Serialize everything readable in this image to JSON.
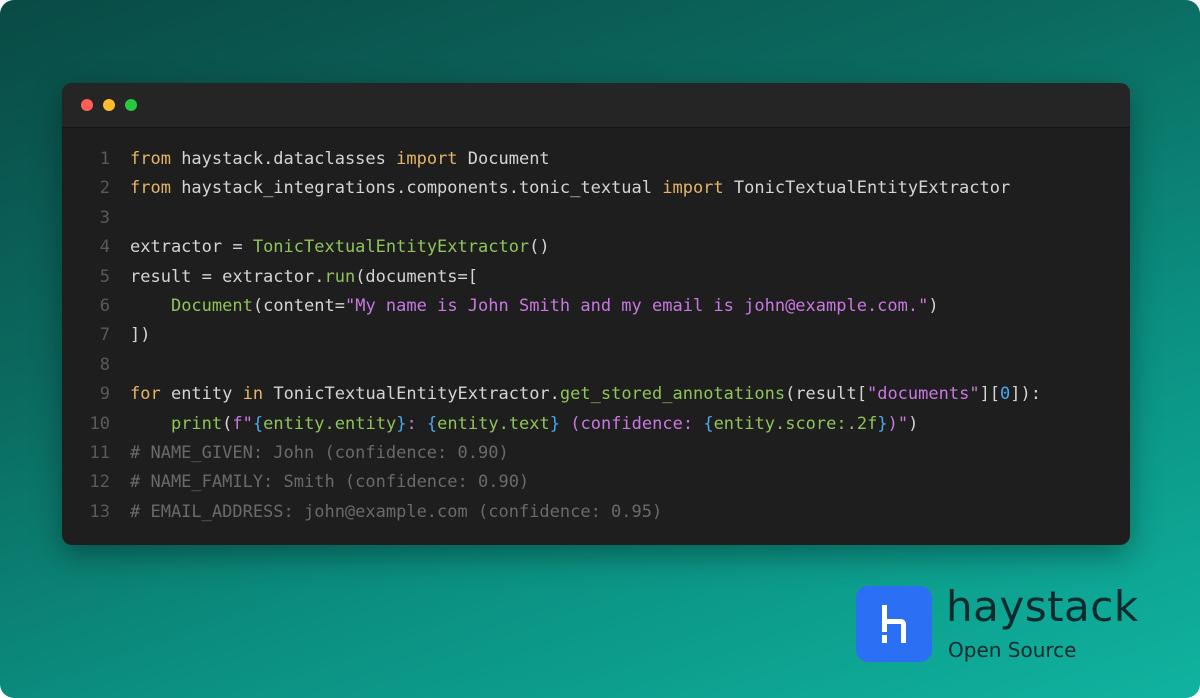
{
  "code": {
    "line_numbers": [
      "1",
      "2",
      "3",
      "4",
      "5",
      "6",
      "7",
      "8",
      "9",
      "10",
      "11",
      "12",
      "13"
    ],
    "lines": [
      [
        {
          "t": "from",
          "c": "kw"
        },
        {
          "t": " haystack.dataclasses ",
          "c": ""
        },
        {
          "t": "import",
          "c": "kw"
        },
        {
          "t": " Document",
          "c": ""
        }
      ],
      [
        {
          "t": "from",
          "c": "kw"
        },
        {
          "t": " haystack_integrations.components.tonic_textual ",
          "c": ""
        },
        {
          "t": "import",
          "c": "kw"
        },
        {
          "t": " TonicTextualEntityExtractor",
          "c": ""
        }
      ],
      [],
      [
        {
          "t": "extractor = ",
          "c": ""
        },
        {
          "t": "TonicTextualEntityExtractor",
          "c": "fn"
        },
        {
          "t": "()",
          "c": ""
        }
      ],
      [
        {
          "t": "result = extractor.",
          "c": ""
        },
        {
          "t": "run",
          "c": "fn"
        },
        {
          "t": "(documents=[",
          "c": ""
        }
      ],
      [
        {
          "t": "    ",
          "c": ""
        },
        {
          "t": "Document",
          "c": "fn"
        },
        {
          "t": "(content=",
          "c": ""
        },
        {
          "t": "\"My name is John Smith and my email is john@example.com.\"",
          "c": "str"
        },
        {
          "t": ")",
          "c": ""
        }
      ],
      [
        {
          "t": "])",
          "c": ""
        }
      ],
      [],
      [
        {
          "t": "for",
          "c": "kw"
        },
        {
          "t": " entity ",
          "c": ""
        },
        {
          "t": "in",
          "c": "kw"
        },
        {
          "t": " TonicTextualEntityExtractor.",
          "c": ""
        },
        {
          "t": "get_stored_annotations",
          "c": "fn"
        },
        {
          "t": "(result[",
          "c": ""
        },
        {
          "t": "\"documents\"",
          "c": "str"
        },
        {
          "t": "][",
          "c": ""
        },
        {
          "t": "0",
          "c": "brace"
        },
        {
          "t": "]):",
          "c": ""
        }
      ],
      [
        {
          "t": "    ",
          "c": ""
        },
        {
          "t": "print",
          "c": "fn"
        },
        {
          "t": "(",
          "c": ""
        },
        {
          "t": "f\"",
          "c": "str"
        },
        {
          "t": "{",
          "c": "brace"
        },
        {
          "t": "entity.entity",
          "c": "fn"
        },
        {
          "t": "}",
          "c": "brace"
        },
        {
          "t": ": ",
          "c": "str"
        },
        {
          "t": "{",
          "c": "brace"
        },
        {
          "t": "entity.text",
          "c": "fn"
        },
        {
          "t": "}",
          "c": "brace"
        },
        {
          "t": " (confidence: ",
          "c": "str"
        },
        {
          "t": "{",
          "c": "brace"
        },
        {
          "t": "entity.score:.2f",
          "c": "fn"
        },
        {
          "t": "}",
          "c": "brace"
        },
        {
          "t": ")\"",
          "c": "str"
        },
        {
          "t": ")",
          "c": ""
        }
      ],
      [
        {
          "t": "# NAME_GIVEN: John (confidence: 0.90)",
          "c": "cm"
        }
      ],
      [
        {
          "t": "# NAME_FAMILY: Smith (confidence: 0.90)",
          "c": "cm"
        }
      ],
      [
        {
          "t": "# EMAIL_ADDRESS: john@example.com (confidence: 0.95)",
          "c": "cm"
        }
      ]
    ]
  },
  "brand": {
    "name": "haystack",
    "subtitle": "Open Source",
    "logo_color": "#2b6ff5"
  },
  "colors": {
    "keyword": "#e5b567",
    "function": "#8fc45a",
    "string": "#c878e0",
    "brace": "#4aa8f0",
    "comment": "#6a6a6a"
  }
}
